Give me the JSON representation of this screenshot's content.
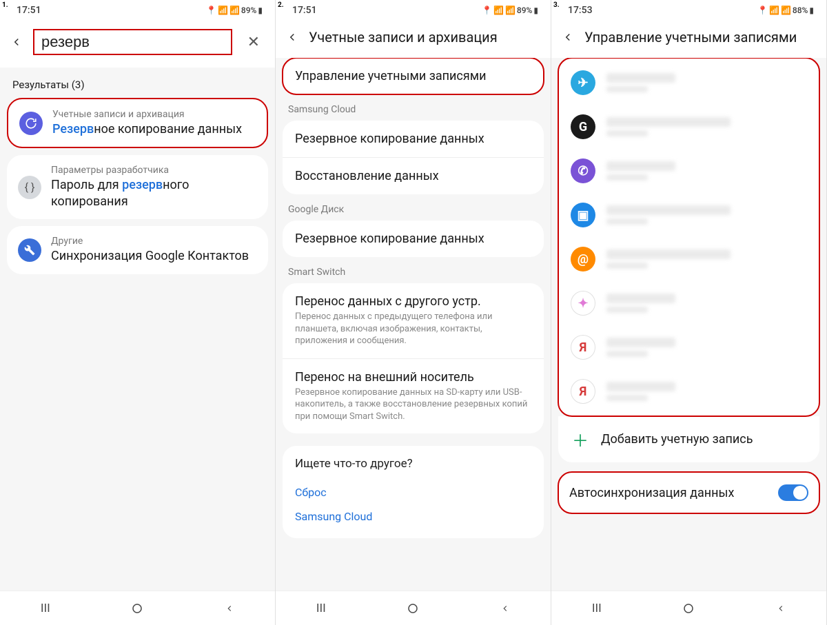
{
  "step_labels": [
    "1.",
    "2.",
    "3."
  ],
  "screen1": {
    "status": {
      "time": "17:51",
      "battery": "89%"
    },
    "search_value": "резерв",
    "results_label": "Результаты (3)",
    "results": [
      {
        "breadcrumb": "Учетные записи и архивация",
        "prefix": "Резерв",
        "suffix": "ное копирование данных"
      },
      {
        "breadcrumb": "Параметры разработчика",
        "prefix_plain": "Пароль для ",
        "hl": "резерв",
        "suffix": "ного копирования"
      },
      {
        "breadcrumb": "Другие",
        "title_plain": "Синхронизация Google Контактов"
      }
    ]
  },
  "screen2": {
    "status": {
      "time": "17:51",
      "battery": "89%"
    },
    "title": "Учетные записи и архивация",
    "manage": "Управление учетными записями",
    "sections": {
      "samsung": {
        "label": "Samsung Cloud",
        "items": [
          "Резервное копирование данных",
          "Восстановление данных"
        ]
      },
      "google": {
        "label": "Google Диск",
        "items": [
          "Резервное копирование данных"
        ]
      },
      "smartswitch": {
        "label": "Smart Switch",
        "items": [
          {
            "title": "Перенос данных с другого устр.",
            "sub": "Перенос данных с предыдущего телефона или планшета, включая изображения, контакты, приложения и сообщения."
          },
          {
            "title": "Перенос на внешний носитель",
            "sub": "Резервное копирование данных на SD-карту или USB-накопитель, а также восстановление резервных копий при помощи Smart Switch."
          }
        ]
      }
    },
    "looking": {
      "title": "Ищете что-то другое?",
      "links": [
        "Сброс",
        "Samsung Cloud"
      ]
    }
  },
  "screen3": {
    "status": {
      "time": "17:53",
      "battery": "88%"
    },
    "title": "Управление учетными записями",
    "add_label": "Добавить учетную запись",
    "autosync": "Автосинхронизация данных",
    "account_icons": [
      {
        "bg": "#2aa8e0",
        "glyph": "✈"
      },
      {
        "bg": "#1a1a1a",
        "glyph": "G"
      },
      {
        "bg": "#7a52d6",
        "glyph": "✆"
      },
      {
        "bg": "#1e88e5",
        "glyph": "▣"
      },
      {
        "bg": "#ff8a00",
        "glyph": "@"
      },
      {
        "bg": "#ffffff",
        "glyph": "✦",
        "fg": "#e07ad6"
      },
      {
        "bg": "#ffffff",
        "glyph": "Я",
        "fg": "#d63b3b"
      },
      {
        "bg": "#ffffff",
        "glyph": "Я",
        "fg": "#d63b3b"
      }
    ]
  }
}
